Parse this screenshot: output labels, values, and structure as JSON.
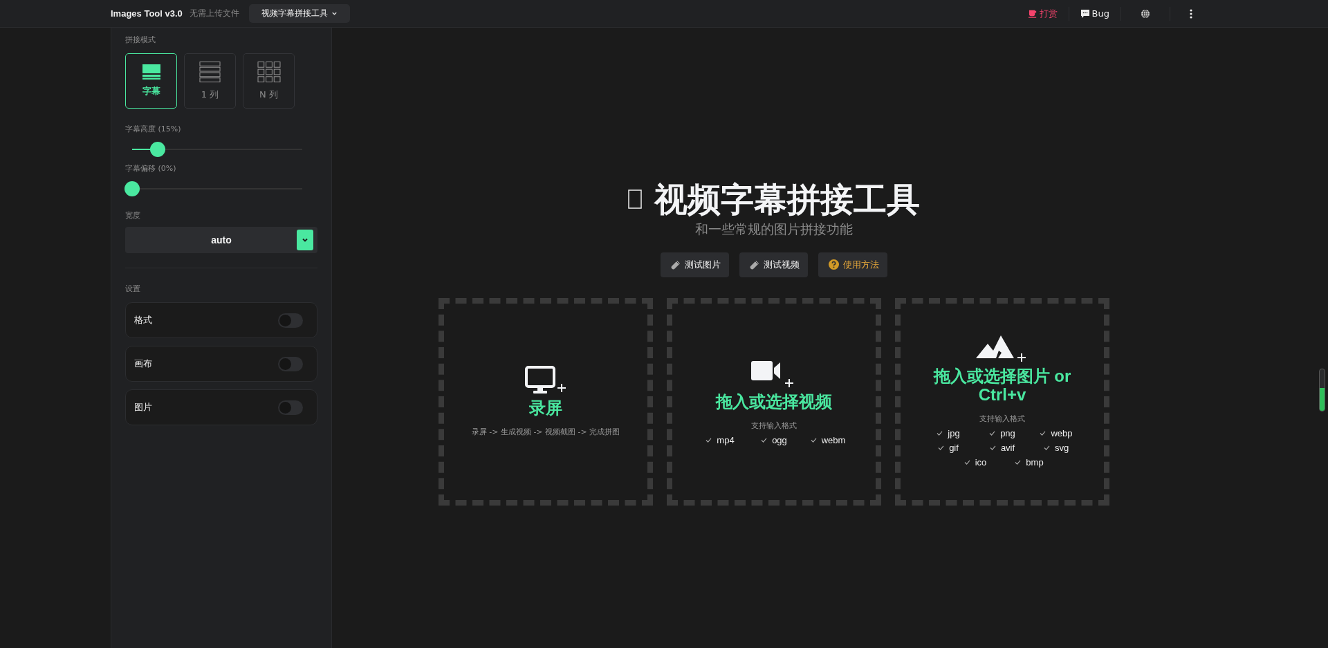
{
  "header": {
    "app_name": "Images Tool v3.0",
    "tagline": "无需上传文件",
    "tool_selector": "视频字幕拼接工具",
    "actions": [
      {
        "kind": "donate",
        "label": "打赏"
      },
      {
        "kind": "bug",
        "label": "Bug"
      },
      {
        "kind": "language"
      },
      {
        "kind": "more"
      }
    ]
  },
  "sidebar": {
    "mode_label": "拼接模式",
    "modes": [
      {
        "kind": "subtitle",
        "label": "字幕",
        "selected": true
      },
      {
        "kind": "column",
        "label": "1 列",
        "selected": false
      },
      {
        "kind": "grid",
        "label": "N 列",
        "selected": false
      }
    ],
    "sliders": [
      {
        "label": "字幕高度 (15%)",
        "level": 0.15
      },
      {
        "label": "字幕偏移 (0%)",
        "level": 0
      }
    ],
    "width_label": "宽度",
    "width_value": "auto",
    "settings_label": "设置",
    "settings": [
      {
        "label": "格式",
        "on": false
      },
      {
        "label": "画布",
        "on": false
      },
      {
        "label": "图片",
        "on": false
      }
    ]
  },
  "main": {
    "title": "视频字幕拼接工具",
    "subtitle": "和一些常规的图片拼接功能",
    "buttons": [
      {
        "kind": "sample",
        "label": "测试图片"
      },
      {
        "kind": "sample",
        "label": "测试视频"
      },
      {
        "kind": "help",
        "label": "使用方法"
      }
    ],
    "drop_zones": [
      {
        "kind": "screen",
        "title": "录屏",
        "description": "录屏 -> 生成视频 -> 视频截图 -> 完成拼图"
      },
      {
        "kind": "video",
        "title": "拖入或选择视频",
        "formats_label": "支持输入格式",
        "formats": [
          "mp4",
          "ogg",
          "webm"
        ]
      },
      {
        "kind": "image",
        "title": "拖入或选择图片 or Ctrl+v",
        "formats_label": "支持输入格式",
        "formats": [
          "jpg",
          "png",
          "webp",
          "gif",
          "avif",
          "svg",
          "ico",
          "bmp"
        ]
      }
    ]
  }
}
